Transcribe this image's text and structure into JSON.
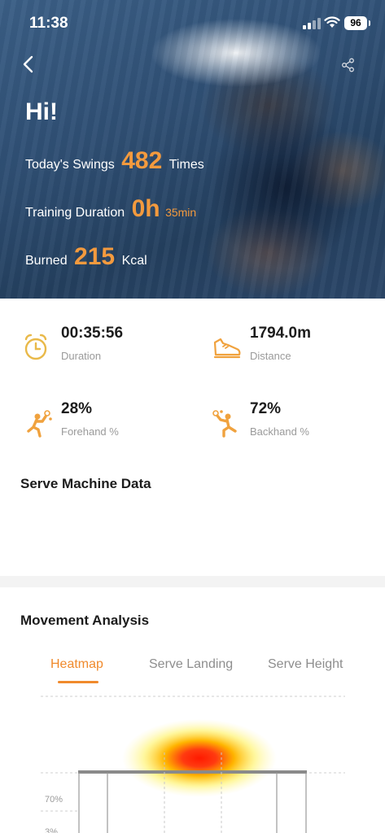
{
  "status_bar": {
    "time": "11:38",
    "battery": "96"
  },
  "hero": {
    "greeting": "Hi!",
    "swings": {
      "label": "Today's Swings",
      "value": "482",
      "unit": "Times"
    },
    "training": {
      "label": "Training Duration",
      "hours": "0h",
      "minutes": "35min"
    },
    "burned": {
      "label": "Burned",
      "value": "215",
      "unit": "Kcal"
    }
  },
  "metrics": {
    "duration": {
      "value": "00:35:56",
      "label": "Duration",
      "icon": "alarm-clock-icon"
    },
    "distance": {
      "value": "1794.0m",
      "label": "Distance",
      "icon": "sneaker-icon"
    },
    "forehand": {
      "value": "28%",
      "label": "Forehand %",
      "icon": "forehand-player-icon"
    },
    "backhand": {
      "value": "72%",
      "label": "Backhand %",
      "icon": "backhand-player-icon"
    }
  },
  "serve_machine": {
    "title": "Serve Machine Data"
  },
  "movement": {
    "title": "Movement Analysis",
    "tabs": [
      {
        "label": "Heatmap",
        "active": true
      },
      {
        "label": "Serve Landing",
        "active": false
      },
      {
        "label": "Serve Height",
        "active": false
      }
    ],
    "percent_labels": [
      "70%",
      "3%"
    ]
  },
  "colors": {
    "accent": "#f39a3e",
    "tab_active": "#f08a2c",
    "icon_orange": "#f0a23e",
    "clock_yellow": "#e9b949"
  }
}
